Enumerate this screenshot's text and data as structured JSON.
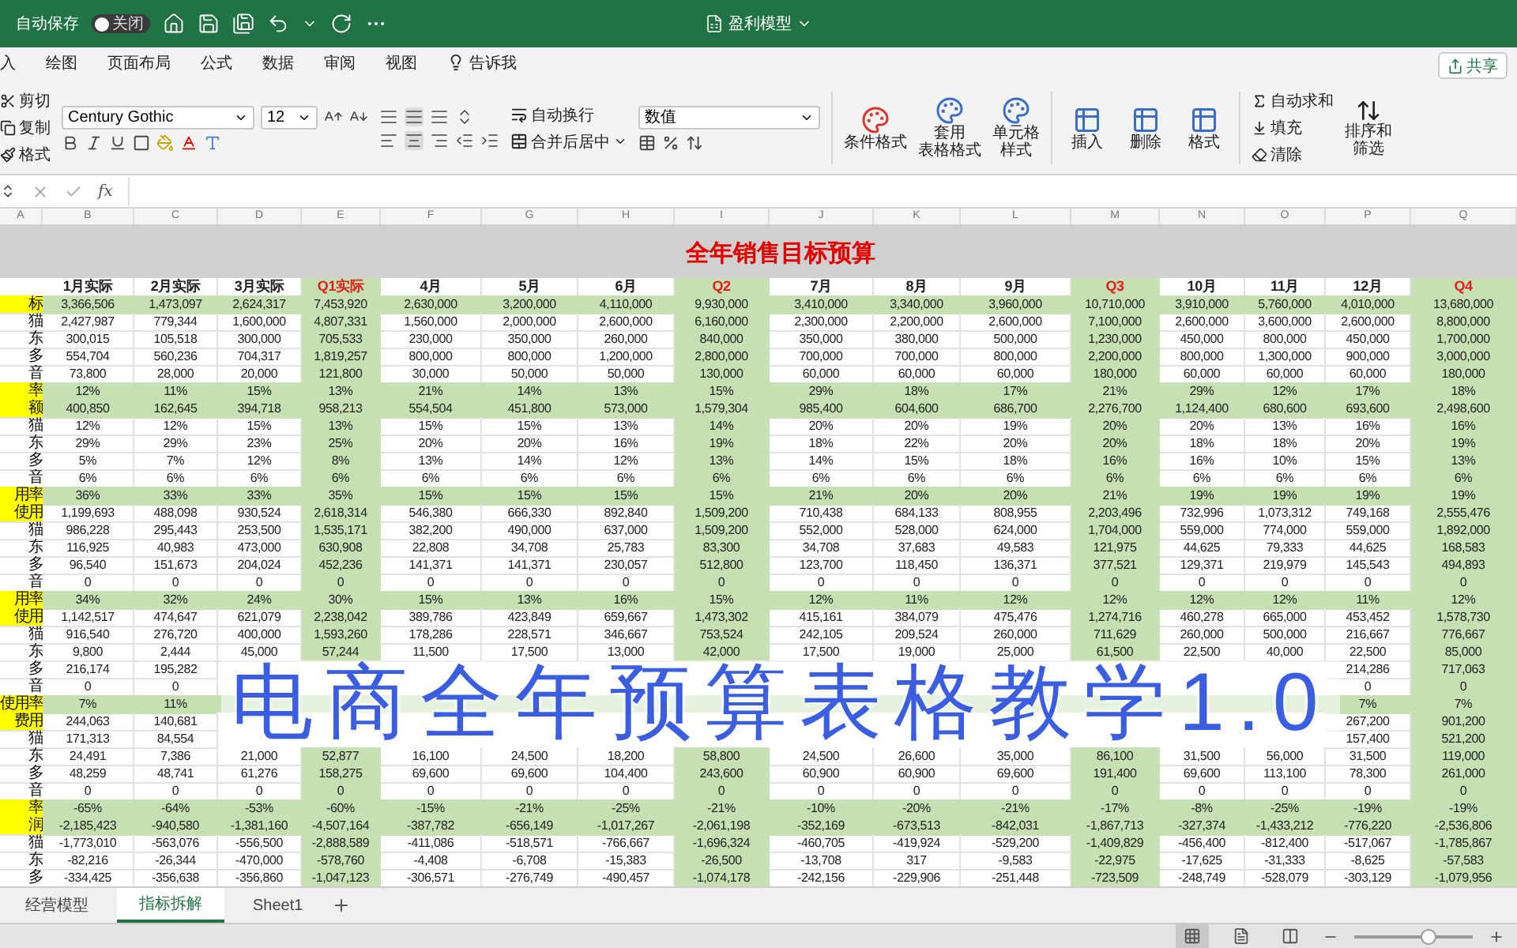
{
  "title_bar": {
    "autosave_label": "自动保存",
    "autosave_toggle": {
      "on": false,
      "label": "关闭"
    },
    "document_title": "盈利模型"
  },
  "menu_tabs": [
    {
      "label": "入",
      "kind": "tab",
      "selected": false
    },
    {
      "label": "绘图",
      "kind": "tab",
      "selected": false
    },
    {
      "label": "页面布局",
      "kind": "tab",
      "selected": false
    },
    {
      "label": "公式",
      "kind": "tab",
      "selected": false
    },
    {
      "label": "数据",
      "kind": "tab",
      "selected": false
    },
    {
      "label": "审阅",
      "kind": "tab",
      "selected": false
    },
    {
      "label": "视图",
      "kind": "tab",
      "selected": false
    },
    {
      "label": "告诉我",
      "kind": "search",
      "selected": false
    }
  ],
  "share_button": "共享",
  "ribbon": {
    "clipboard": [
      "剪切",
      "复制",
      "格式"
    ],
    "font_family": "Century Gothic",
    "font_size": "12",
    "wrap_text": "自动换行",
    "merge_center": "合并后居中",
    "number_format": "数值",
    "style_buttons": [
      {
        "lines": [
          "条件格式"
        ]
      },
      {
        "lines": [
          "套用",
          "表格格式"
        ]
      },
      {
        "lines": [
          "单元格",
          "样式"
        ]
      }
    ],
    "cell_buttons": [
      "插入",
      "删除",
      "格式"
    ],
    "editing": [
      "自动求和",
      "填充",
      "清除"
    ],
    "sort_filter": [
      "排序和",
      "筛选"
    ]
  },
  "formula_bar": {
    "fx_label": "fx"
  },
  "sheet": {
    "title": "全年销售目标预算",
    "label_column_letter": "A",
    "columns": [
      {
        "letter": "B",
        "header": "1月实际",
        "kind": "month"
      },
      {
        "letter": "C",
        "header": "2月实际",
        "kind": "month"
      },
      {
        "letter": "D",
        "header": "3月实际",
        "kind": "month"
      },
      {
        "letter": "E",
        "header": "Q1实际",
        "kind": "quarter"
      },
      {
        "letter": "F",
        "header": "4月",
        "kind": "month"
      },
      {
        "letter": "G",
        "header": "5月",
        "kind": "month"
      },
      {
        "letter": "H",
        "header": "6月",
        "kind": "month"
      },
      {
        "letter": "I",
        "header": "Q2",
        "kind": "quarter"
      },
      {
        "letter": "J",
        "header": "7月",
        "kind": "month"
      },
      {
        "letter": "K",
        "header": "8月",
        "kind": "month"
      },
      {
        "letter": "L",
        "header": "9月",
        "kind": "month"
      },
      {
        "letter": "M",
        "header": "Q3",
        "kind": "quarter"
      },
      {
        "letter": "N",
        "header": "10月",
        "kind": "month"
      },
      {
        "letter": "O",
        "header": "11月",
        "kind": "month"
      },
      {
        "letter": "P",
        "header": "12月",
        "kind": "month"
      },
      {
        "letter": "Q",
        "header": "Q4",
        "kind": "quarter"
      }
    ],
    "rows": [
      {
        "label": "标",
        "highlighted": true,
        "banded": true,
        "cells": [
          "3,366,506",
          "1,473,097",
          "2,624,317",
          "7,453,920",
          "2,630,000",
          "3,200,000",
          "4,110,000",
          "9,930,000",
          "3,410,000",
          "3,340,000",
          "3,960,000",
          "10,710,000",
          "3,910,000",
          "5,760,000",
          "4,010,000",
          "13,680,000"
        ]
      },
      {
        "label": "猫",
        "highlighted": false,
        "banded": false,
        "cells": [
          "2,427,987",
          "779,344",
          "1,600,000",
          "4,807,331",
          "1,560,000",
          "2,000,000",
          "2,600,000",
          "6,160,000",
          "2,300,000",
          "2,200,000",
          "2,600,000",
          "7,100,000",
          "2,600,000",
          "3,600,000",
          "2,600,000",
          "8,800,000"
        ]
      },
      {
        "label": "东",
        "highlighted": false,
        "banded": false,
        "cells": [
          "300,015",
          "105,518",
          "300,000",
          "705,533",
          "230,000",
          "350,000",
          "260,000",
          "840,000",
          "350,000",
          "380,000",
          "500,000",
          "1,230,000",
          "450,000",
          "800,000",
          "450,000",
          "1,700,000"
        ]
      },
      {
        "label": "多",
        "highlighted": false,
        "banded": false,
        "cells": [
          "554,704",
          "560,236",
          "704,317",
          "1,819,257",
          "800,000",
          "800,000",
          "1,200,000",
          "2,800,000",
          "700,000",
          "700,000",
          "800,000",
          "2,200,000",
          "800,000",
          "1,300,000",
          "900,000",
          "3,000,000"
        ]
      },
      {
        "label": "音",
        "highlighted": false,
        "banded": false,
        "cells": [
          "73,800",
          "28,000",
          "20,000",
          "121,800",
          "30,000",
          "50,000",
          "50,000",
          "130,000",
          "60,000",
          "60,000",
          "60,000",
          "180,000",
          "60,000",
          "60,000",
          "60,000",
          "180,000"
        ]
      },
      {
        "label": "率",
        "highlighted": true,
        "banded": true,
        "cells": [
          "12%",
          "11%",
          "15%",
          "13%",
          "21%",
          "14%",
          "13%",
          "15%",
          "29%",
          "18%",
          "17%",
          "21%",
          "29%",
          "12%",
          "17%",
          "18%"
        ]
      },
      {
        "label": "额",
        "highlighted": true,
        "banded": true,
        "cells": [
          "400,850",
          "162,645",
          "394,718",
          "958,213",
          "554,504",
          "451,800",
          "573,000",
          "1,579,304",
          "985,400",
          "604,600",
          "686,700",
          "2,276,700",
          "1,124,400",
          "680,600",
          "693,600",
          "2,498,600"
        ]
      },
      {
        "label": "猫",
        "highlighted": false,
        "banded": false,
        "cells": [
          "12%",
          "12%",
          "15%",
          "13%",
          "15%",
          "15%",
          "13%",
          "14%",
          "20%",
          "20%",
          "19%",
          "20%",
          "20%",
          "13%",
          "16%",
          "16%"
        ]
      },
      {
        "label": "东",
        "highlighted": false,
        "banded": false,
        "cells": [
          "29%",
          "29%",
          "23%",
          "25%",
          "20%",
          "20%",
          "16%",
          "19%",
          "18%",
          "22%",
          "20%",
          "20%",
          "18%",
          "18%",
          "20%",
          "19%"
        ]
      },
      {
        "label": "多",
        "highlighted": false,
        "banded": false,
        "cells": [
          "5%",
          "7%",
          "12%",
          "8%",
          "13%",
          "14%",
          "12%",
          "13%",
          "14%",
          "15%",
          "18%",
          "16%",
          "16%",
          "10%",
          "15%",
          "13%"
        ]
      },
      {
        "label": "音",
        "highlighted": false,
        "banded": false,
        "cells": [
          "6%",
          "6%",
          "6%",
          "6%",
          "6%",
          "6%",
          "6%",
          "6%",
          "6%",
          "6%",
          "6%",
          "6%",
          "6%",
          "6%",
          "6%",
          "6%"
        ]
      },
      {
        "label": "用率",
        "highlighted": true,
        "banded": true,
        "cells": [
          "36%",
          "33%",
          "33%",
          "35%",
          "15%",
          "15%",
          "15%",
          "15%",
          "21%",
          "20%",
          "20%",
          "21%",
          "19%",
          "19%",
          "19%",
          "19%"
        ]
      },
      {
        "label": "使用",
        "highlighted": true,
        "banded": false,
        "cells": [
          "1,199,693",
          "488,098",
          "930,524",
          "2,618,314",
          "546,380",
          "666,330",
          "892,840",
          "1,509,200",
          "710,438",
          "684,133",
          "808,955",
          "2,203,496",
          "732,996",
          "1,073,312",
          "749,168",
          "2,555,476"
        ]
      },
      {
        "label": "猫",
        "highlighted": false,
        "banded": false,
        "cells": [
          "986,228",
          "295,443",
          "253,500",
          "1,535,171",
          "382,200",
          "490,000",
          "637,000",
          "1,509,200",
          "552,000",
          "528,000",
          "624,000",
          "1,704,000",
          "559,000",
          "774,000",
          "559,000",
          "1,892,000"
        ]
      },
      {
        "label": "东",
        "highlighted": false,
        "banded": false,
        "cells": [
          "116,925",
          "40,983",
          "473,000",
          "630,908",
          "22,808",
          "34,708",
          "25,783",
          "83,300",
          "34,708",
          "37,683",
          "49,583",
          "121,975",
          "44,625",
          "79,333",
          "44,625",
          "168,583"
        ]
      },
      {
        "label": "多",
        "highlighted": false,
        "banded": false,
        "cells": [
          "96,540",
          "151,673",
          "204,024",
          "452,236",
          "141,371",
          "141,371",
          "230,057",
          "512,800",
          "123,700",
          "118,450",
          "136,371",
          "377,521",
          "129,371",
          "219,979",
          "145,543",
          "494,893"
        ]
      },
      {
        "label": "音",
        "highlighted": false,
        "banded": false,
        "cells": [
          "0",
          "0",
          "0",
          "0",
          "0",
          "0",
          "0",
          "0",
          "0",
          "0",
          "0",
          "0",
          "0",
          "0",
          "0",
          "0"
        ]
      },
      {
        "label": "用率",
        "highlighted": true,
        "banded": true,
        "cells": [
          "34%",
          "32%",
          "24%",
          "30%",
          "15%",
          "13%",
          "16%",
          "15%",
          "12%",
          "11%",
          "12%",
          "12%",
          "12%",
          "12%",
          "11%",
          "12%"
        ]
      },
      {
        "label": "使用",
        "highlighted": true,
        "banded": false,
        "cells": [
          "1,142,517",
          "474,647",
          "621,079",
          "2,238,042",
          "389,786",
          "423,849",
          "659,667",
          "1,473,302",
          "415,161",
          "384,079",
          "475,476",
          "1,274,716",
          "460,278",
          "665,000",
          "453,452",
          "1,578,730"
        ]
      },
      {
        "label": "猫",
        "highlighted": false,
        "banded": false,
        "cells": [
          "916,540",
          "276,720",
          "400,000",
          "1,593,260",
          "178,286",
          "228,571",
          "346,667",
          "753,524",
          "242,105",
          "209,524",
          "260,000",
          "711,629",
          "260,000",
          "500,000",
          "216,667",
          "776,667"
        ]
      },
      {
        "label": "东",
        "highlighted": false,
        "banded": false,
        "cells": [
          "9,800",
          "2,444",
          "45,000",
          "57,244",
          "11,500",
          "17,500",
          "13,000",
          "42,000",
          "17,500",
          "19,000",
          "25,000",
          "61,500",
          "22,500",
          "40,000",
          "22,500",
          "85,000"
        ]
      },
      {
        "label": "多",
        "highlighted": false,
        "banded": false,
        "cells": [
          "216,174",
          "195,282",
          null,
          null,
          null,
          null,
          null,
          null,
          null,
          null,
          null,
          null,
          null,
          null,
          "214,286",
          "717,063"
        ]
      },
      {
        "label": "音",
        "highlighted": false,
        "banded": false,
        "cells": [
          "0",
          "0",
          null,
          null,
          null,
          null,
          null,
          null,
          null,
          null,
          null,
          null,
          null,
          null,
          "0",
          "0"
        ]
      },
      {
        "label": "使用率",
        "highlighted": true,
        "banded": true,
        "cells": [
          "7%",
          "11%",
          null,
          null,
          null,
          null,
          null,
          null,
          null,
          null,
          null,
          null,
          null,
          null,
          "7%",
          "7%"
        ]
      },
      {
        "label": "费用",
        "highlighted": true,
        "banded": false,
        "cells": [
          "244,063",
          "140,681",
          null,
          null,
          null,
          null,
          null,
          null,
          null,
          null,
          null,
          null,
          null,
          null,
          "267,200",
          "901,200"
        ]
      },
      {
        "label": "猫",
        "highlighted": false,
        "banded": false,
        "cells": [
          "171,313",
          "84,554",
          null,
          null,
          null,
          null,
          null,
          null,
          null,
          null,
          null,
          null,
          null,
          null,
          "157,400",
          "521,200"
        ]
      },
      {
        "label": "东",
        "highlighted": false,
        "banded": false,
        "cells": [
          "24,491",
          "7,386",
          "21,000",
          "52,877",
          "16,100",
          "24,500",
          "18,200",
          "58,800",
          "24,500",
          "26,600",
          "35,000",
          "86,100",
          "31,500",
          "56,000",
          "31,500",
          "119,000"
        ]
      },
      {
        "label": "多",
        "highlighted": false,
        "banded": false,
        "cells": [
          "48,259",
          "48,741",
          "61,276",
          "158,275",
          "69,600",
          "69,600",
          "104,400",
          "243,600",
          "60,900",
          "60,900",
          "69,600",
          "191,400",
          "69,600",
          "113,100",
          "78,300",
          "261,000"
        ]
      },
      {
        "label": "音",
        "highlighted": false,
        "banded": false,
        "cells": [
          "0",
          "0",
          "0",
          "0",
          "0",
          "0",
          "0",
          "0",
          "0",
          "0",
          "0",
          "0",
          "0",
          "0",
          "0",
          "0"
        ]
      },
      {
        "label": "率",
        "highlighted": true,
        "banded": true,
        "cells": [
          "-65%",
          "-64%",
          "-53%",
          "-60%",
          "-15%",
          "-21%",
          "-25%",
          "-21%",
          "-10%",
          "-20%",
          "-21%",
          "-17%",
          "-8%",
          "-25%",
          "-19%",
          "-19%"
        ]
      },
      {
        "label": "润",
        "highlighted": true,
        "banded": true,
        "cells": [
          "-2,185,423",
          "-940,580",
          "-1,381,160",
          "-4,507,164",
          "-387,782",
          "-656,149",
          "-1,017,267",
          "-2,061,198",
          "-352,169",
          "-673,513",
          "-842,031",
          "-1,867,713",
          "-327,374",
          "-1,433,212",
          "-776,220",
          "-2,536,806"
        ]
      },
      {
        "label": "猫",
        "highlighted": false,
        "banded": false,
        "cells": [
          "-1,773,010",
          "-563,076",
          "-556,500",
          "-2,888,589",
          "-411,086",
          "-518,571",
          "-766,667",
          "-1,696,324",
          "-460,705",
          "-419,924",
          "-529,200",
          "-1,409,829",
          "-456,400",
          "-812,400",
          "-517,067",
          "-1,785,867"
        ]
      },
      {
        "label": "东",
        "highlighted": false,
        "banded": false,
        "cells": [
          "-82,216",
          "-26,344",
          "-470,000",
          "-578,760",
          "-4,408",
          "-6,708",
          "-15,383",
          "-26,500",
          "-13,708",
          "317",
          "-9,583",
          "-22,975",
          "-17,625",
          "-31,333",
          "-8,625",
          "-57,583"
        ]
      },
      {
        "label": "多",
        "highlighted": false,
        "banded": false,
        "cells": [
          "-334,425",
          "-356,638",
          "-356,860",
          "-1,047,123",
          "-306,571",
          "-276,749",
          "-490,457",
          "-1,074,178",
          "-242,156",
          "-229,906",
          "-251,448",
          "-723,509",
          "-248,749",
          "-528,079",
          "-303,129",
          "-1,079,956"
        ]
      }
    ]
  },
  "overlay_caption": "电商全年预算表格教学1.0",
  "sheet_tabs": [
    {
      "label": "经营模型",
      "selected": false
    },
    {
      "label": "指标拆解",
      "selected": true
    },
    {
      "label": "Sheet1",
      "selected": false
    }
  ],
  "status_bar": {
    "views": [
      {
        "kind": "normal",
        "selected": true
      },
      {
        "kind": "page_layout",
        "selected": false
      },
      {
        "kind": "page_break",
        "selected": false
      }
    ],
    "zoom": {
      "level": 0.62
    }
  }
}
